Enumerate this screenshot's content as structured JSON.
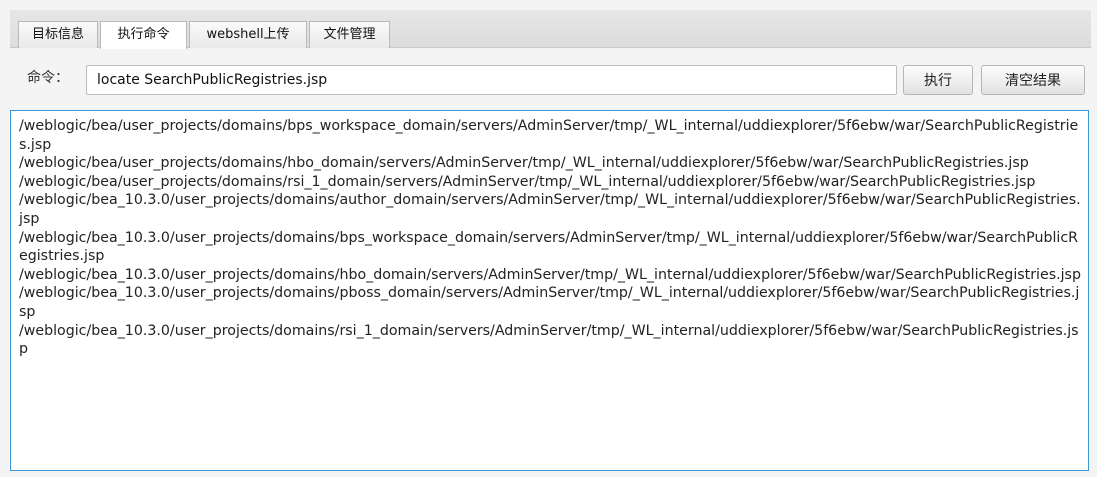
{
  "tabs": [
    {
      "label": "目标信息"
    },
    {
      "label": "执行命令"
    },
    {
      "label": "webshell上传"
    },
    {
      "label": "文件管理"
    }
  ],
  "command": {
    "label": "命令：",
    "value": "locate SearchPublicRegistries.jsp",
    "execute_label": "执行",
    "clear_label": "清空结果"
  },
  "result": {
    "lines": [
      "/weblogic/bea/user_projects/domains/bps_workspace_domain/servers/AdminServer/tmp/_WL_internal/uddiexplorer/5f6ebw/war/SearchPublicRegistries.jsp",
      "/weblogic/bea/user_projects/domains/hbo_domain/servers/AdminServer/tmp/_WL_internal/uddiexplorer/5f6ebw/war/SearchPublicRegistries.jsp",
      "/weblogic/bea/user_projects/domains/rsi_1_domain/servers/AdminServer/tmp/_WL_internal/uddiexplorer/5f6ebw/war/SearchPublicRegistries.jsp",
      "/weblogic/bea_10.3.0/user_projects/domains/author_domain/servers/AdminServer/tmp/_WL_internal/uddiexplorer/5f6ebw/war/SearchPublicRegistries.jsp",
      "/weblogic/bea_10.3.0/user_projects/domains/bps_workspace_domain/servers/AdminServer/tmp/_WL_internal/uddiexplorer/5f6ebw/war/SearchPublicRegistries.jsp",
      "/weblogic/bea_10.3.0/user_projects/domains/hbo_domain/servers/AdminServer/tmp/_WL_internal/uddiexplorer/5f6ebw/war/SearchPublicRegistries.jsp",
      "/weblogic/bea_10.3.0/user_projects/domains/pboss_domain/servers/AdminServer/tmp/_WL_internal/uddiexplorer/5f6ebw/war/SearchPublicRegistries.jsp",
      "/weblogic/bea_10.3.0/user_projects/domains/rsi_1_domain/servers/AdminServer/tmp/_WL_internal/uddiexplorer/5f6ebw/war/SearchPublicRegistries.jsp"
    ]
  }
}
